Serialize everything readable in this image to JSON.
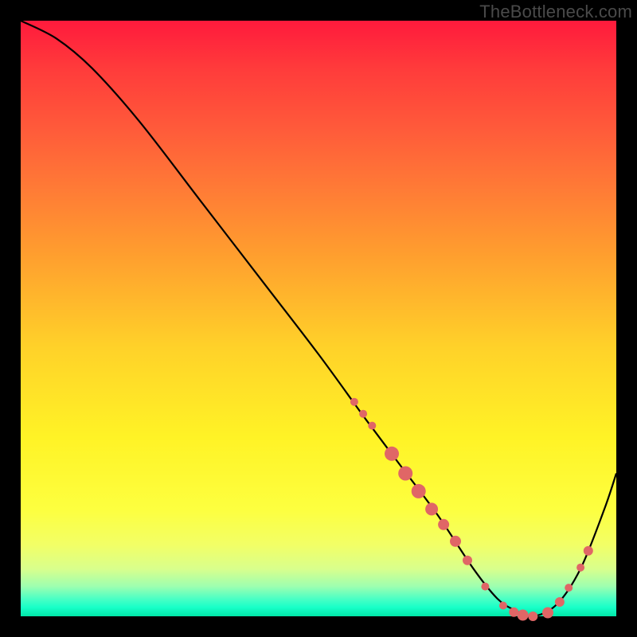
{
  "watermark": "TheBottleneck.com",
  "colors": {
    "frame": "#000000",
    "curve": "#000000",
    "marker_fill": "#e06666",
    "marker_stroke": "#cc5555"
  },
  "chart_data": {
    "type": "line",
    "title": "",
    "xlabel": "",
    "ylabel": "",
    "xlim": [
      0,
      100
    ],
    "ylim": [
      0,
      100
    ],
    "grid": false,
    "series": [
      {
        "name": "bottleneck-curve",
        "x": [
          0,
          6,
          12,
          20,
          30,
          40,
          50,
          58,
          64,
          70,
          76,
          80,
          83,
          86,
          90,
          94,
          98,
          100
        ],
        "values": [
          100,
          97,
          92,
          83,
          70,
          57,
          44,
          33,
          25,
          17,
          8,
          3,
          1,
          0,
          2,
          8,
          18,
          24
        ]
      }
    ],
    "markers": [
      {
        "x": 56.0,
        "y": 36.0,
        "r": 5
      },
      {
        "x": 57.5,
        "y": 34.0,
        "r": 5
      },
      {
        "x": 59.0,
        "y": 32.0,
        "r": 5
      },
      {
        "x": 62.3,
        "y": 27.3,
        "r": 9
      },
      {
        "x": 64.6,
        "y": 24.0,
        "r": 9
      },
      {
        "x": 66.8,
        "y": 21.0,
        "r": 9
      },
      {
        "x": 69.0,
        "y": 18.0,
        "r": 8
      },
      {
        "x": 71.0,
        "y": 15.4,
        "r": 7
      },
      {
        "x": 73.0,
        "y": 12.6,
        "r": 7
      },
      {
        "x": 75.0,
        "y": 9.4,
        "r": 6
      },
      {
        "x": 78.0,
        "y": 5.0,
        "r": 5
      },
      {
        "x": 81.0,
        "y": 1.8,
        "r": 5
      },
      {
        "x": 82.8,
        "y": 0.7,
        "r": 6
      },
      {
        "x": 84.3,
        "y": 0.2,
        "r": 7
      },
      {
        "x": 86.0,
        "y": 0.0,
        "r": 6
      },
      {
        "x": 88.5,
        "y": 0.6,
        "r": 7
      },
      {
        "x": 90.5,
        "y": 2.4,
        "r": 6
      },
      {
        "x": 92.0,
        "y": 4.8,
        "r": 5
      },
      {
        "x": 94.0,
        "y": 8.2,
        "r": 5
      },
      {
        "x": 95.3,
        "y": 11.0,
        "r": 6
      }
    ]
  }
}
